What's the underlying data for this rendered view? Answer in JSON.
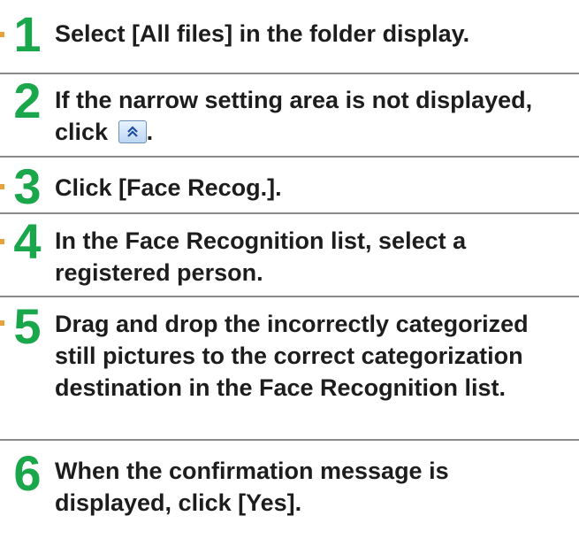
{
  "steps": [
    {
      "number": "1",
      "text": "Select [All files] in the folder display."
    },
    {
      "number": "2",
      "text_before": "If the narrow setting area is not displayed, click",
      "text_after": ".",
      "icon": "chevron-up-double-icon"
    },
    {
      "number": "3",
      "text": "Click [Face Recog.]."
    },
    {
      "number": "4",
      "text": "In the Face Recognition list, select a registered person."
    },
    {
      "number": "5",
      "text": "Drag and drop the incorrectly categorized still pictures to the correct categorization destination in the Face Recognition list."
    },
    {
      "number": "6",
      "text": "When the confirmation message is displayed, click [Yes]."
    }
  ],
  "colors": {
    "step_number": "#1aa64a",
    "divider": "#8a8a8a",
    "marker": "#e8a23c"
  }
}
